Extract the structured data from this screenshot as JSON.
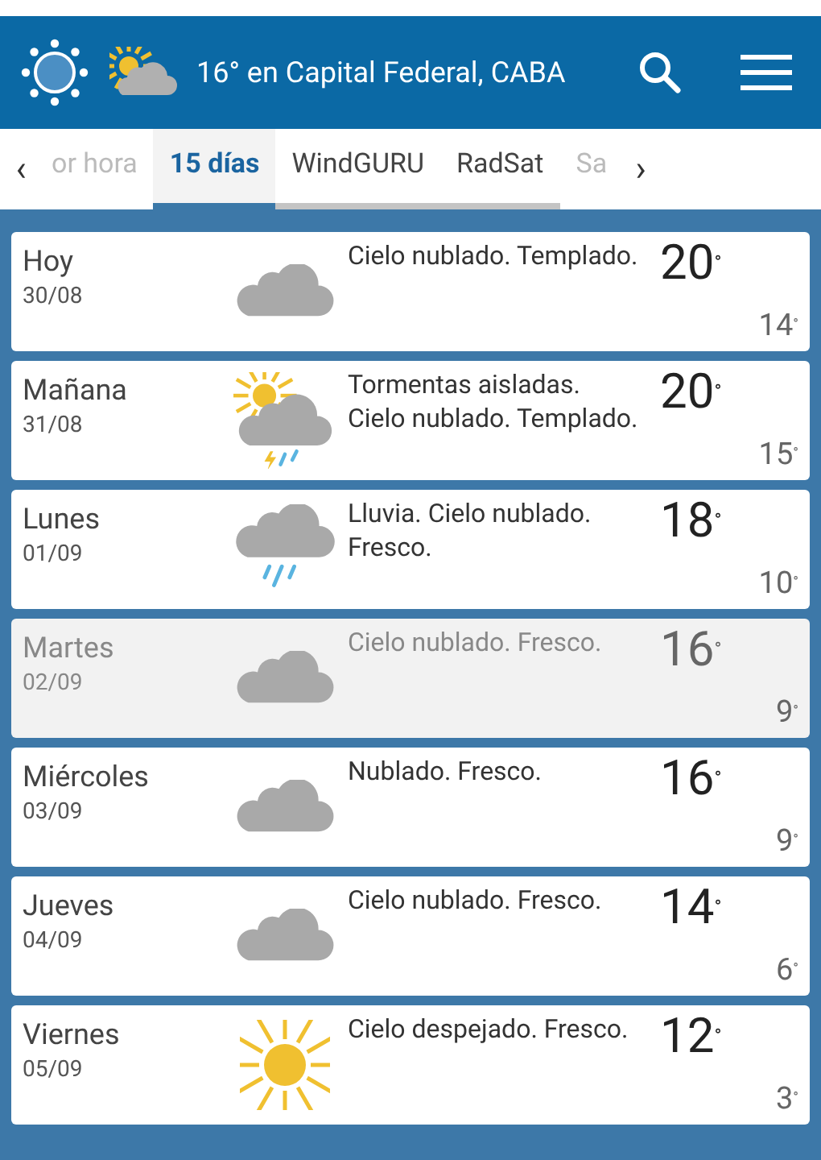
{
  "header": {
    "title": "16° en Capital Federal, CABA"
  },
  "tabs": [
    {
      "label": "or hora",
      "selected": false,
      "faded": true
    },
    {
      "label": "15 días",
      "selected": true,
      "faded": false
    },
    {
      "label": "WindGURU",
      "selected": false,
      "faded": false
    },
    {
      "label": "RadSat",
      "selected": false,
      "faded": false
    },
    {
      "label": "Sa",
      "selected": false,
      "faded": true
    }
  ],
  "tab_prev": "‹",
  "tab_next": "›",
  "days": [
    {
      "day": "Hoy",
      "date": "30/08",
      "kind": "cloud",
      "summary": "Cielo nublado. Templado.",
      "high": "20$^{°}$",
      "low": "14$^{°}$",
      "selected": false
    },
    {
      "day": "Mañana",
      "date": "31/08",
      "kind": "storm",
      "summary": "Tormentas aisladas. Cielo nublado. Templado.",
      "high": "20$^{°}$",
      "low": "15$^{°}$",
      "selected": false
    },
    {
      "day": "Lunes",
      "date": "01/09",
      "kind": "rain",
      "summary": "Lluvia. Cielo nublado. Fresco.",
      "high": "18$^{°}$",
      "low": "10$^{°}$",
      "selected": false
    },
    {
      "day": "Martes",
      "date": "02/09",
      "kind": "cloud",
      "summary": "Cielo nublado. Fresco.",
      "high": "16$^{°}$",
      "low": "9$^{°}$",
      "selected": true
    },
    {
      "day": "Miércoles",
      "date": "03/09",
      "kind": "cloud",
      "summary": "Nublado. Fresco.",
      "high": "16$^{°}$",
      "low": "9$^{°}$",
      "selected": false
    },
    {
      "day": "Jueves",
      "date": "04/09",
      "kind": "cloud",
      "summary": "Cielo nublado. Fresco.",
      "high": "14$^{°}$",
      "low": "6$^{°}$",
      "selected": false
    },
    {
      "day": "Viernes",
      "date": "05/09",
      "kind": "sun",
      "summary": "Cielo despejado. Fresco.",
      "high": "12$^{°}$",
      "low": "3$^{°}$",
      "selected": false
    }
  ]
}
